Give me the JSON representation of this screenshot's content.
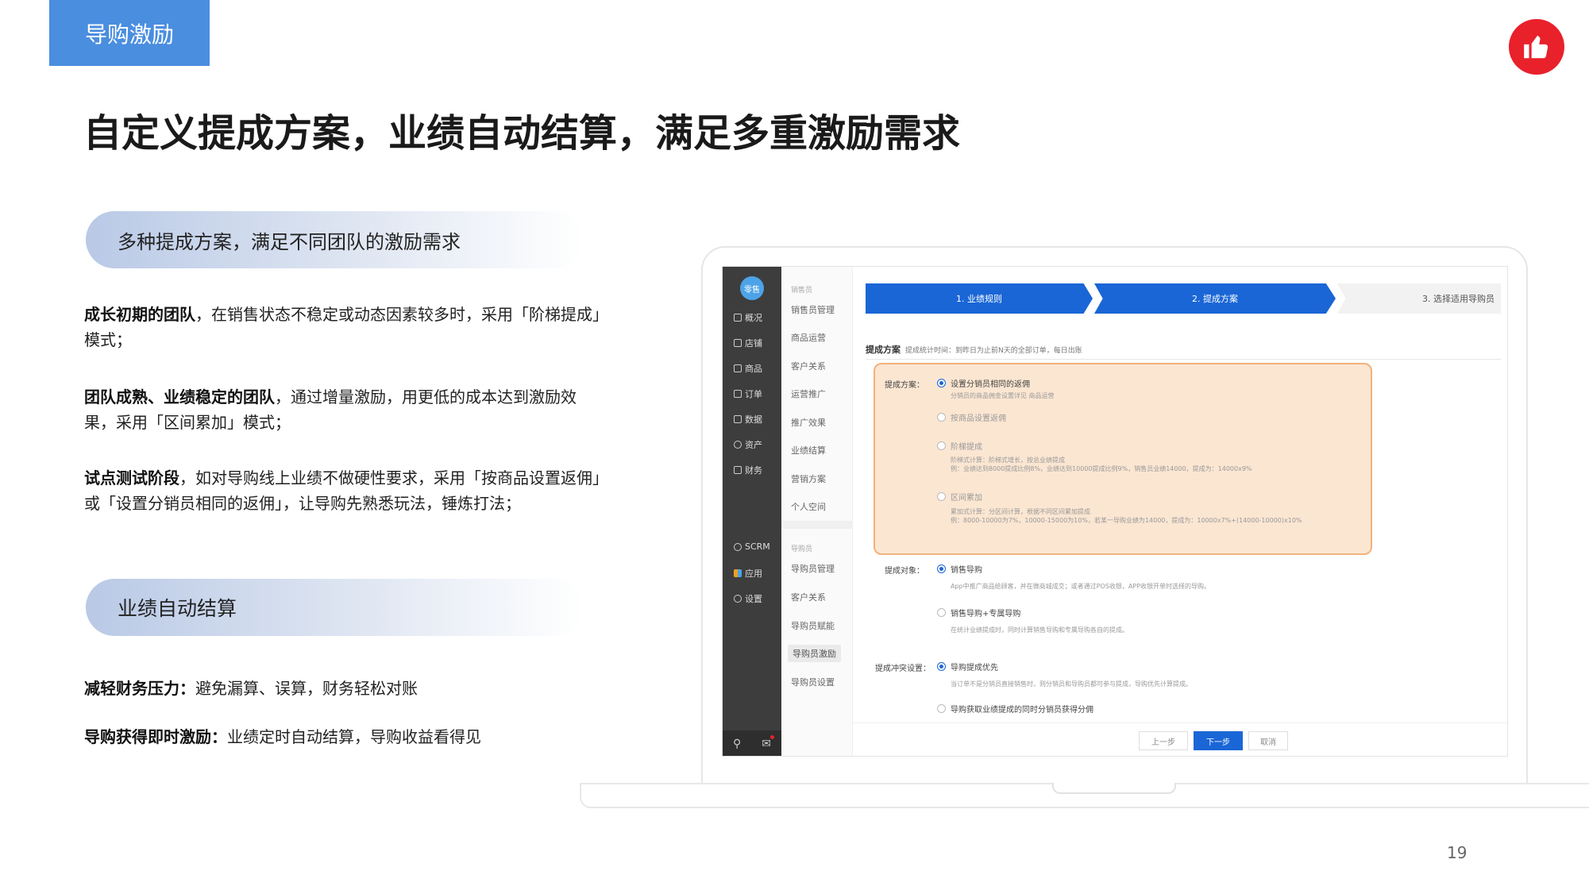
{
  "header": {
    "tag_label": "导购激励",
    "title": "自定义提成方案，业绩自动结算，满足多重激励需求"
  },
  "section1": {
    "heading": "多种提成方案，满足不同团队的激励需求",
    "items": [
      {
        "bold": "成长初期的团队",
        "text": "，在销售状态不稳定或动态因素较多时，采用「阶梯提成」模式；"
      },
      {
        "bold": "团队成熟、业绩稳定的团队",
        "text": "，通过增量激励，用更低的成本达到激励效果，采用「区间累加」模式；"
      },
      {
        "bold": "试点测试阶段",
        "text": "，如对导购线上业绩不做硬性要求，采用「按商品设置返佣」或「设置分销员相同的返佣」，让导购先熟悉玩法，锤炼打法；"
      }
    ]
  },
  "section2": {
    "heading": "业绩自动结算",
    "items": [
      {
        "bold": "减轻财务压力：",
        "text": "避免漏算、误算，财务轻松对账"
      },
      {
        "bold": "导购获得即时激励：",
        "text": "业绩定时自动结算，导购收益看得见"
      }
    ]
  },
  "page_number": "19",
  "app": {
    "logo": "零售",
    "sidebar": [
      {
        "label": "概况",
        "icon": "overview-icon"
      },
      {
        "label": "店铺",
        "icon": "store-icon"
      },
      {
        "label": "商品",
        "icon": "tag-icon"
      },
      {
        "label": "订单",
        "icon": "order-icon"
      },
      {
        "label": "数据",
        "icon": "chart-icon"
      },
      {
        "label": "资产",
        "icon": "asset-icon"
      },
      {
        "label": "财务",
        "icon": "finance-icon"
      },
      {
        "label": "SCRM",
        "icon": "user-icon"
      },
      {
        "label": "应用",
        "icon": "apps-icon"
      },
      {
        "label": "设置",
        "icon": "gear-icon"
      }
    ],
    "submenu_group1": {
      "head": "销售员",
      "items": [
        "销售员管理",
        "商品运营",
        "客户关系",
        "运营推广",
        "推广效果",
        "业绩结算",
        "营销方案",
        "个人空间"
      ]
    },
    "submenu_group2": {
      "head": "导购员",
      "items": [
        "导购员管理",
        "客户关系",
        "导购员赋能",
        "导购员激励",
        "导购员设置"
      ]
    },
    "steps": [
      "1. 业绩规则",
      "2. 提成方案",
      "3. 选择适用导购员"
    ],
    "section_title": "提成方案",
    "section_note": "提成统计时间：到昨日为止前N天的全部订单，每日出账",
    "plan_label": "提成方案：",
    "plan_options": [
      {
        "label": "设置分销员相同的返佣",
        "hint": "分销员的商品佣金设置详见 商品运营",
        "checked": true
      },
      {
        "label": "按商品设置返佣",
        "hint": "",
        "checked": false
      },
      {
        "label": "阶梯提成",
        "hint": "阶梯式计算：阶梯式增长，按总业绩提成\n例：业绩达到8000提成比例8%，业绩达到10000提成比例9%，销售员业绩14000，提成为：14000x9%",
        "checked": false
      },
      {
        "label": "区间累加",
        "hint": "累加式计算：分区间计算，根据不同区间累加提成\n例：8000-10000为7%，10000-15000为10%，若某一导购业绩为14000，提成为：10000x7%+(14000-10000)x10%",
        "checked": false
      }
    ],
    "target_label": "提成对象：",
    "target_options": [
      {
        "label": "销售导购",
        "hint": "App中推广商品给顾客，并在微商城成交；或者通过POS收银，APP收银开单时选择的导购。",
        "checked": true
      },
      {
        "label": "销售导购+专属导购",
        "hint": "在统计业绩提成时，同时计算销售导购和专属导购各自的提成。",
        "checked": false
      }
    ],
    "conflict_label": "提成冲突设置：",
    "conflict_options": [
      {
        "label": "导购提成优先",
        "hint": "当订单不是分销员直接销售时，则分销员和导购员都可参与提成，导购优先计算提成。",
        "checked": true
      },
      {
        "label": "导购获取业绩提成的同时分销员获得分佣",
        "hint": "",
        "checked": false
      }
    ],
    "buttons": {
      "prev": "上一步",
      "next": "下一步",
      "cancel": "取消"
    }
  },
  "colors": {
    "tag_bg": "#4a8ee0",
    "like_badge": "#e8212b",
    "step_active": "#1a66d6",
    "highlight_bg": "#fbe6d2",
    "highlight_border": "#f1b27c"
  }
}
